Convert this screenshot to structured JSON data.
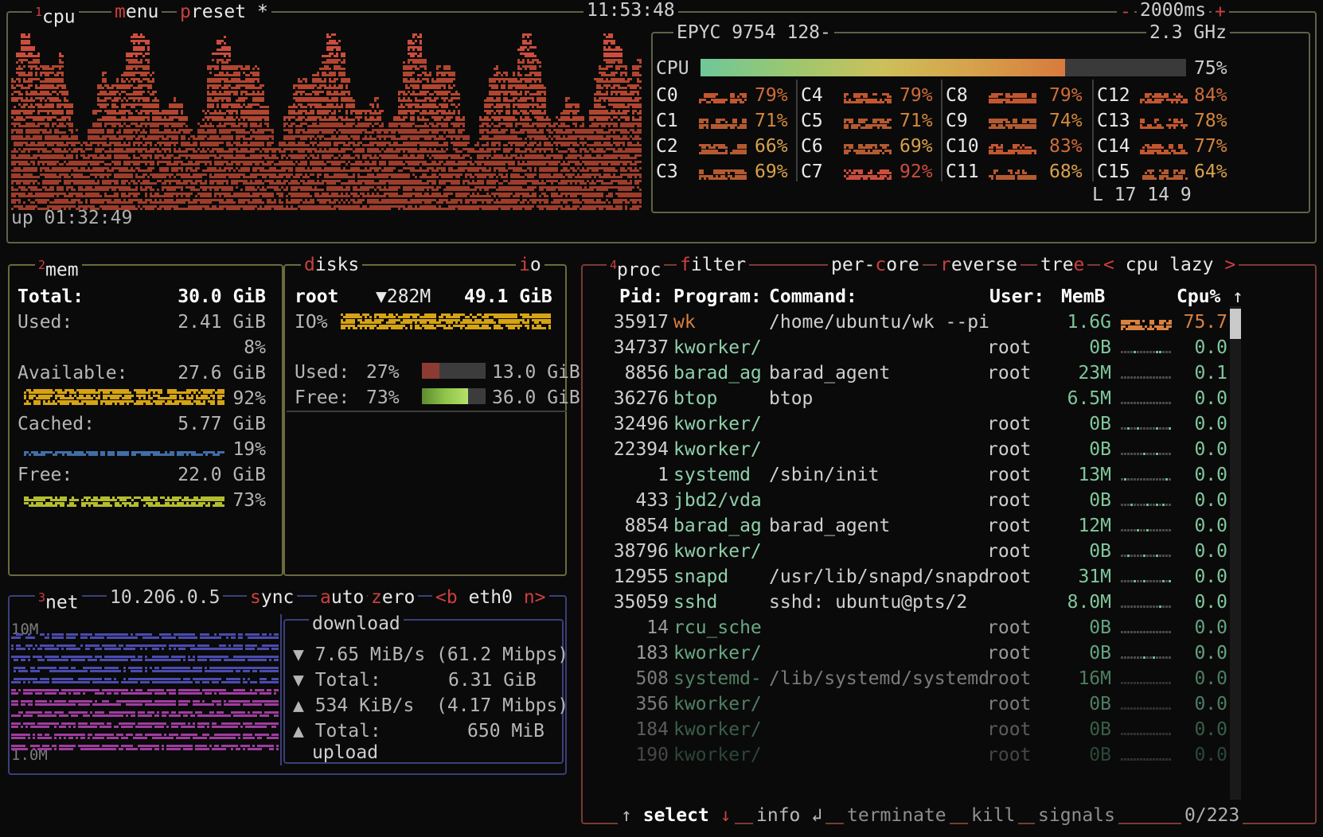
{
  "app": "btop",
  "cpu_panel": {
    "num": "1",
    "title": "cpu",
    "menu": "menu",
    "preset": "preset",
    "preset_star": "*",
    "clock": "11:53:48",
    "minus": "-",
    "update_ms": "2000ms",
    "plus": "+",
    "uptime": "up 01:32:49",
    "model": "EPYC 9754 128-",
    "freq": "2.3 GHz",
    "total_label": "CPU",
    "total_pct": "75%",
    "total_value": 75,
    "load_label": "L",
    "load": [
      "17",
      "14",
      "9"
    ],
    "cores": [
      {
        "name": "C0",
        "pct": "79%",
        "v": 79
      },
      {
        "name": "C4",
        "pct": "79%",
        "v": 79
      },
      {
        "name": "C8",
        "pct": "79%",
        "v": 79
      },
      {
        "name": "C12",
        "pct": "84%",
        "v": 84
      },
      {
        "name": "C1",
        "pct": "71%",
        "v": 71
      },
      {
        "name": "C5",
        "pct": "71%",
        "v": 71
      },
      {
        "name": "C9",
        "pct": "74%",
        "v": 74
      },
      {
        "name": "C13",
        "pct": "78%",
        "v": 78
      },
      {
        "name": "C2",
        "pct": "66%",
        "v": 66
      },
      {
        "name": "C6",
        "pct": "69%",
        "v": 69
      },
      {
        "name": "C10",
        "pct": "83%",
        "v": 83
      },
      {
        "name": "C14",
        "pct": "77%",
        "v": 77
      },
      {
        "name": "C3",
        "pct": "69%",
        "v": 69
      },
      {
        "name": "C7",
        "pct": "92%",
        "v": 92
      },
      {
        "name": "C11",
        "pct": "68%",
        "v": 68
      },
      {
        "name": "C15",
        "pct": "64%",
        "v": 64
      }
    ]
  },
  "mem_panel": {
    "num": "2",
    "title": "mem",
    "rows": [
      {
        "label": "Total:",
        "value": "30.0 GiB",
        "pct": "",
        "bold": true
      },
      {
        "label": "Used:",
        "value": "2.41 GiB",
        "pct": "8%",
        "fill": 8,
        "color": "#8c3b32"
      },
      {
        "label": "Available:",
        "value": "27.6 GiB",
        "pct": "92%",
        "fill": 92,
        "color": "#d6a314"
      },
      {
        "label": "Cached:",
        "value": "5.77 GiB",
        "pct": "19%",
        "fill": 19,
        "color": "#3f6ea8"
      },
      {
        "label": "Free:",
        "value": "22.0 GiB",
        "pct": "73%",
        "fill": 73,
        "color": "#b4bd2e"
      }
    ]
  },
  "disks_panel": {
    "title": "disks",
    "io_label": "io",
    "name": "root",
    "io_rate": "▼282M",
    "size": "49.1 GiB",
    "io_pct_label": "IO%",
    "io_fill": 100,
    "used_label": "Used:",
    "used_pct": "27%",
    "used_value": "13.0 GiB",
    "used_fill": 27,
    "free_label": "Free:",
    "free_pct": "73%",
    "free_value": "36.0 GiB",
    "free_fill": 73
  },
  "net_panel": {
    "num": "3",
    "title": "net",
    "ip": "10.206.0.5",
    "sync": "sync",
    "auto": "auto",
    "zero": "zero",
    "iface_prev": "<b",
    "iface": "eth0",
    "iface_next": "n>",
    "down_scale_top": "10M",
    "up_scale_bottom": "1.0M",
    "download_label": "download",
    "upload_label": "upload",
    "down_rate": "▼ 7.65 MiB/s (61.2 Mibps)",
    "down_total_label": "▼ Total:",
    "down_total": "6.31 GiB",
    "up_rate": "▲ 534 KiB/s  (4.17 Mibps)",
    "up_total_label": "▲ Total:",
    "up_total": "650 MiB"
  },
  "proc_panel": {
    "num": "4",
    "title": "proc",
    "filter": "filter",
    "per_core": "per-core",
    "reverse": "reverse",
    "tree": "tree",
    "sort_prev": "<",
    "sort": "cpu lazy",
    "sort_next": ">",
    "sort_arrow": "↑",
    "headers": {
      "pid": "Pid:",
      "program": "Program:",
      "command": "Command:",
      "user": "User:",
      "mem": "MemB",
      "cpu": "Cpu%"
    },
    "rows": [
      {
        "pid": "35917",
        "program": "wk",
        "command": "/home/ubuntu/wk --pi",
        "user": "",
        "mem": "1.6G",
        "cpu": "75.7",
        "hot": true,
        "fade": 0
      },
      {
        "pid": "34737",
        "program": "kworker/",
        "command": "",
        "user": "root",
        "mem": "0B",
        "cpu": "0.0",
        "hot": false,
        "fade": 0
      },
      {
        "pid": "8856",
        "program": "barad_ag",
        "command": "barad_agent",
        "user": "root",
        "mem": "23M",
        "cpu": "0.1",
        "hot": false,
        "fade": 0
      },
      {
        "pid": "36276",
        "program": "btop",
        "command": "btop",
        "user": "",
        "mem": "6.5M",
        "cpu": "0.0",
        "hot": false,
        "fade": 0
      },
      {
        "pid": "32496",
        "program": "kworker/",
        "command": "",
        "user": "root",
        "mem": "0B",
        "cpu": "0.0",
        "hot": false,
        "fade": 0
      },
      {
        "pid": "22394",
        "program": "kworker/",
        "command": "",
        "user": "root",
        "mem": "0B",
        "cpu": "0.0",
        "hot": false,
        "fade": 0
      },
      {
        "pid": "1",
        "program": "systemd",
        "command": "/sbin/init",
        "user": "root",
        "mem": "13M",
        "cpu": "0.0",
        "hot": false,
        "fade": 0
      },
      {
        "pid": "433",
        "program": "jbd2/vda",
        "command": "",
        "user": "root",
        "mem": "0B",
        "cpu": "0.0",
        "hot": false,
        "fade": 0
      },
      {
        "pid": "8854",
        "program": "barad_ag",
        "command": "barad_agent",
        "user": "root",
        "mem": "12M",
        "cpu": "0.0",
        "hot": false,
        "fade": 0
      },
      {
        "pid": "38796",
        "program": "kworker/",
        "command": "",
        "user": "root",
        "mem": "0B",
        "cpu": "0.0",
        "hot": false,
        "fade": 0
      },
      {
        "pid": "12955",
        "program": "snapd",
        "command": "/usr/lib/snapd/snapd",
        "user": "root",
        "mem": "31M",
        "cpu": "0.0",
        "hot": false,
        "fade": 0
      },
      {
        "pid": "35059",
        "program": "sshd",
        "command": "sshd: ubuntu@pts/2",
        "user": "",
        "mem": "8.0M",
        "cpu": "0.0",
        "hot": false,
        "fade": 0
      },
      {
        "pid": "14",
        "program": "rcu_sche",
        "command": "",
        "user": "root",
        "mem": "0B",
        "cpu": "0.0",
        "hot": false,
        "fade": 1
      },
      {
        "pid": "183",
        "program": "kworker/",
        "command": "",
        "user": "root",
        "mem": "0B",
        "cpu": "0.0",
        "hot": false,
        "fade": 1
      },
      {
        "pid": "508",
        "program": "systemd-",
        "command": "/lib/systemd/systemd",
        "user": "root",
        "mem": "16M",
        "cpu": "0.0",
        "hot": false,
        "fade": 2
      },
      {
        "pid": "356",
        "program": "kworker/",
        "command": "",
        "user": "root",
        "mem": "0B",
        "cpu": "0.0",
        "hot": false,
        "fade": 2
      },
      {
        "pid": "184",
        "program": "kworker/",
        "command": "",
        "user": "root",
        "mem": "0B",
        "cpu": "0.0",
        "hot": false,
        "fade": 3
      },
      {
        "pid": "190",
        "program": "kworker/",
        "command": "",
        "user": "root",
        "mem": "0B",
        "cpu": "0.0",
        "hot": false,
        "fade": 4
      }
    ],
    "footer": {
      "up_arrow": "↑",
      "select": "select",
      "down_arrow": "↓",
      "info": "info",
      "enter": "↲",
      "terminate": "terminate",
      "kill": "kill",
      "signals": "signals",
      "count": "0/223"
    }
  },
  "colors": {
    "accent_red": "#cc3f3f",
    "green": "#6fbf8f",
    "orange": "#d9813f",
    "yellow": "#d6a23a",
    "frame_olive": "#5c6348",
    "frame_blue": "#3b3f78",
    "frame_red": "#7a3b36"
  }
}
